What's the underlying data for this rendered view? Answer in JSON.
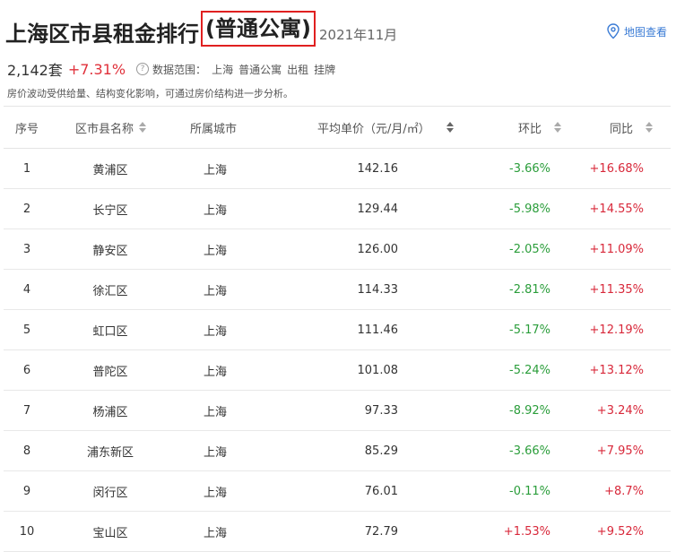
{
  "header": {
    "title": "上海区市县租金排行",
    "title_highlight": "(普通公寓)",
    "date": "2021年11月",
    "map_link": "地图查看",
    "map_icon": "map-pin-icon"
  },
  "summary": {
    "count": "2,142套",
    "change": "+7.31%",
    "range_label": "数据范围：",
    "range_values": [
      "上海",
      "普通公寓",
      "出租",
      "挂牌"
    ],
    "note": "房价波动受供给量、结构变化影响，可通过房价结构进一步分析。"
  },
  "table": {
    "columns": [
      "序号",
      "区市县名称",
      "所属城市",
      "平均单价（元/月/㎡）",
      "环比",
      "同比"
    ],
    "rows": [
      {
        "idx": "1",
        "name": "黄浦区",
        "city": "上海",
        "price": "142.16",
        "mom": "-3.66%",
        "yoy": "+16.68%"
      },
      {
        "idx": "2",
        "name": "长宁区",
        "city": "上海",
        "price": "129.44",
        "mom": "-5.98%",
        "yoy": "+14.55%"
      },
      {
        "idx": "3",
        "name": "静安区",
        "city": "上海",
        "price": "126.00",
        "mom": "-2.05%",
        "yoy": "+11.09%"
      },
      {
        "idx": "4",
        "name": "徐汇区",
        "city": "上海",
        "price": "114.33",
        "mom": "-2.81%",
        "yoy": "+11.35%"
      },
      {
        "idx": "5",
        "name": "虹口区",
        "city": "上海",
        "price": "111.46",
        "mom": "-5.17%",
        "yoy": "+12.19%"
      },
      {
        "idx": "6",
        "name": "普陀区",
        "city": "上海",
        "price": "101.08",
        "mom": "-5.24%",
        "yoy": "+13.12%"
      },
      {
        "idx": "7",
        "name": "杨浦区",
        "city": "上海",
        "price": "97.33",
        "mom": "-8.92%",
        "yoy": "+3.24%"
      },
      {
        "idx": "8",
        "name": "浦东新区",
        "city": "上海",
        "price": "85.29",
        "mom": "-3.66%",
        "yoy": "+7.95%"
      },
      {
        "idx": "9",
        "name": "闵行区",
        "city": "上海",
        "price": "76.01",
        "mom": "-0.11%",
        "yoy": "+8.7%"
      },
      {
        "idx": "10",
        "name": "宝山区",
        "city": "上海",
        "price": "72.79",
        "mom": "+1.53%",
        "yoy": "+9.52%"
      }
    ]
  },
  "colors": {
    "positive": "#d8283a",
    "negative": "#2a9d3a",
    "link": "#3a7bd5",
    "highlight_border": "#e02020"
  }
}
